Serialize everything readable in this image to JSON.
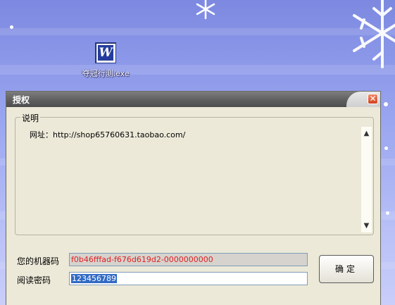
{
  "desktop": {
    "icon_glyph": "W",
    "icon_label": "夺冠行测.exe"
  },
  "dialog": {
    "title": "授权",
    "close_glyph": "✕",
    "groupbox_title": "说明",
    "content_text": "网址：http://shop65760631.taobao.com/",
    "scroll_up_glyph": "▲",
    "scroll_down_glyph": "▼",
    "machine_code_label": "您的机器码",
    "machine_code_value": "f0b46fffad-f676d619d2-0000000000",
    "read_password_label": "阅读密码",
    "read_password_value": "123456789",
    "ok_button_label": "确定"
  },
  "colors": {
    "desktop_background": "#9aa6f0",
    "machine_code_text": "#e02020",
    "selection": "#316ac5"
  }
}
